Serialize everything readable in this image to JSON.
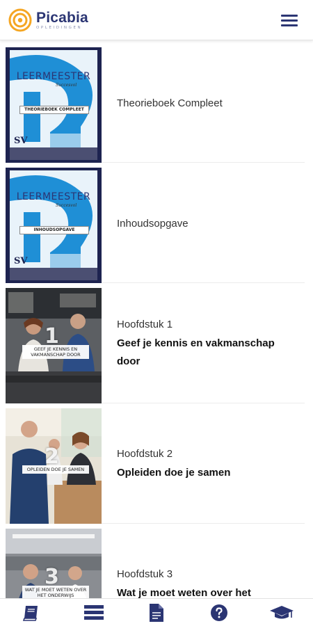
{
  "app": {
    "brand_name": "Picabia",
    "brand_tagline": "OPLEIDINGEN",
    "brand_color": "#2b3573",
    "accent_color": "#f5a623",
    "menu_icon": "hamburger-menu-icon"
  },
  "items": [
    {
      "thumb_type": "book-cover",
      "cover_brand": "LEERMEESTER",
      "cover_brand_sub": "Succesvol",
      "cover_label": "THEORIEBOEK COMPLEET",
      "cover_mono": "SV",
      "title": "Theorieboek Compleet",
      "subtitle": ""
    },
    {
      "thumb_type": "book-cover",
      "cover_brand": "LEERMEESTER",
      "cover_brand_sub": "Succesvol",
      "cover_label": "INHOUDSOPGAVE",
      "cover_mono": "SV",
      "title": "Inhoudsopgave",
      "subtitle": ""
    },
    {
      "thumb_type": "photo",
      "photo_number": "1",
      "photo_caption": "GEEF JE KENNIS EN VAKMANSCHAP DOOR",
      "title": "Hoofdstuk 1",
      "subtitle": "Geef je kennis en vakmanschap door"
    },
    {
      "thumb_type": "photo",
      "photo_number": "2",
      "photo_caption": "OPLEIDEN DOE JE SAMEN",
      "title": "Hoofdstuk 2",
      "subtitle": "Opleiden doe je samen"
    },
    {
      "thumb_type": "photo",
      "photo_number": "3",
      "photo_caption": "WAT JE MOET WETEN OVER HET ONDERWIJS",
      "title": "Hoofdstuk 3",
      "subtitle": "Wat je moet weten over het"
    }
  ],
  "bottom_nav": [
    {
      "icon": "book-icon",
      "active": true
    },
    {
      "icon": "list-icon",
      "active": false
    },
    {
      "icon": "document-icon",
      "active": false
    },
    {
      "icon": "help-icon",
      "active": false
    },
    {
      "icon": "graduation-cap-icon",
      "active": false
    }
  ]
}
